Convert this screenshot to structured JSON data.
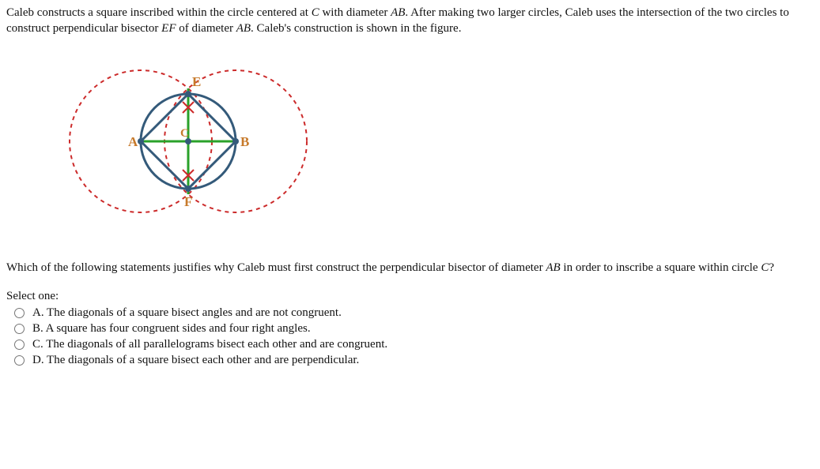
{
  "intro": {
    "seg1": "Caleb constructs a square inscribed within the circle centered at ",
    "C": "C",
    "seg2": " with diameter ",
    "AB1": "AB",
    "seg3": ". After making two larger circles, Caleb uses the intersection of the two circles to construct perpendicular bisector ",
    "EF": "EF",
    "seg4": " of diameter ",
    "AB2": "AB",
    "seg5": ". Caleb's construction is shown in the figure."
  },
  "figure": {
    "label_A": "A",
    "label_B": "B",
    "label_C": "C",
    "label_E": "E",
    "label_F": "F"
  },
  "question": {
    "seg1": "Which of the following statements justifies why Caleb must first construct the perpendicular bisector of diameter ",
    "AB": "AB",
    "seg2": " in order to inscribe a square within circle ",
    "C": "C",
    "seg3": "?"
  },
  "select_label": "Select one:",
  "options": {
    "a": "A. The diagonals of a square bisect angles and are not congruent.",
    "b": "B. A square has four congruent sides and four right angles.",
    "c": "C. The diagonals of all parallelograms bisect each other and are congruent.",
    "d": "D. The diagonals of a square bisect each other and are perpendicular."
  }
}
